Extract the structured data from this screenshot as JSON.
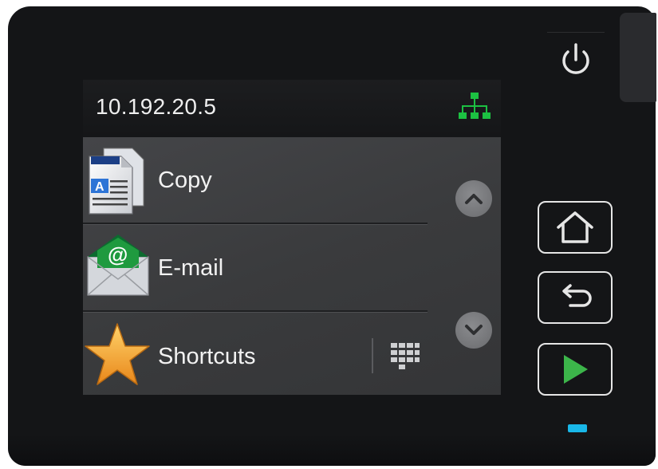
{
  "header": {
    "ip_address": "10.192.20.5",
    "network_icon": "network-icon",
    "network_color": "#1cc142"
  },
  "menu": {
    "items": [
      {
        "label": "Copy",
        "icon": "copy-document-icon"
      },
      {
        "label": "E-mail",
        "icon": "email-envelope-icon"
      },
      {
        "label": "Shortcuts",
        "icon": "star-icon"
      }
    ]
  },
  "scroll": {
    "up_icon": "chevron-up-icon",
    "down_icon": "chevron-down-icon"
  },
  "hardware": {
    "power_icon": "power-icon",
    "home_icon": "home-icon",
    "back_icon": "back-arrow-icon",
    "start_icon": "start-play-icon",
    "start_color": "#3cb54a",
    "led_color": "#19b7e8"
  }
}
